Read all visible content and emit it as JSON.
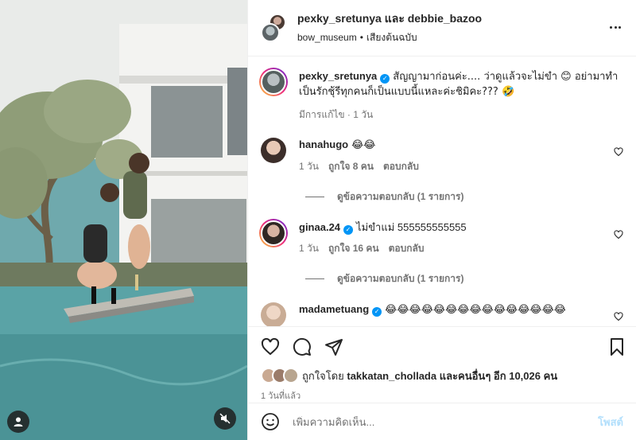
{
  "header": {
    "title_user1": "pexky_sretunya",
    "title_and": "และ",
    "title_user2": "debbie_bazoo",
    "sub_user": "bow_museum",
    "sub_audio": "เสียงต้นฉบับ"
  },
  "caption": {
    "username": "pexky_sretunya",
    "text": "สัญญามาก่อนค่ะ.... ว่าดูแล้วจะไม่ขำ 😊 อย่ามาทำเป็นรักชุ้รีทุกคนก็เป็นแบบนี้แหละค่ะชิมิคะ??? 🤣",
    "edited": "มีการแก้ไข · 1 วัน"
  },
  "comments": [
    {
      "username": "hanahugo",
      "text": "😂😂",
      "time": "1 วัน",
      "likes": "ถูกใจ 8 คน",
      "reply": "ตอบกลับ",
      "view_replies": "ดูข้อความตอบกลับ (1 รายการ)"
    },
    {
      "username": "ginaa.24",
      "text": "ไม่ขำแม่ 555555555555",
      "time": "1 วัน",
      "likes": "ถูกใจ 16 คน",
      "reply": "ตอบกลับ",
      "view_replies": "ดูข้อความตอบกลับ (1 รายการ)"
    },
    {
      "username": "madametuang",
      "text": "😂😂😂😂😂😂😂😂😂😂😂😂😂😂😂"
    }
  ],
  "likes": {
    "prefix": "ถูกใจโดย",
    "user": "takkatan_chollada",
    "suffix": "และคนอื่นๆ อีก 10,026 คน"
  },
  "posted": "1 วันที่แล้ว",
  "composer": {
    "placeholder": "เพิ่มความคิดเห็น...",
    "post": "โพสต์"
  },
  "icons": {
    "more": "more-options-icon",
    "like": "heart-icon",
    "comment": "comment-icon",
    "share": "paper-plane-icon",
    "save": "bookmark-icon",
    "emoji": "smiley-icon",
    "mute": "muted-speaker-icon",
    "tagged": "user-icon",
    "verified": "verified-badge-icon"
  },
  "colors": {
    "verified": "#0095f6",
    "post_button": "#b2dffc",
    "muted_text": "#737373"
  }
}
